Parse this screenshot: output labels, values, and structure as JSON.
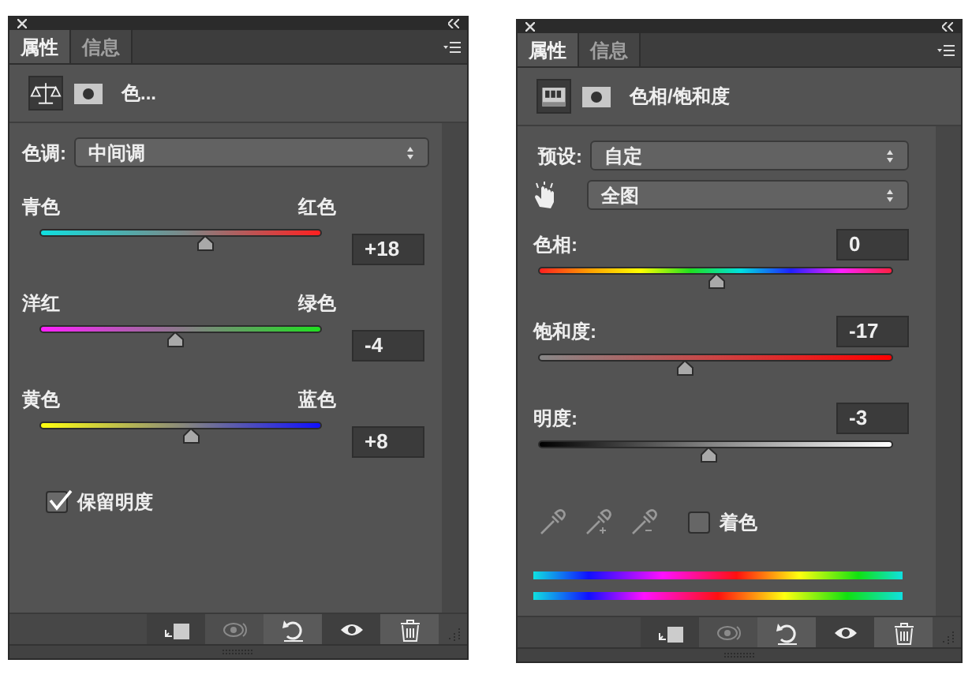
{
  "panels": [
    {
      "tabs": [
        {
          "label": "属性",
          "selected": true
        },
        {
          "label": "信息",
          "selected": false
        }
      ],
      "header": {
        "kind": "color_balance",
        "title": "色..."
      },
      "controls": [
        {
          "kind": "select",
          "label": "色调:",
          "value": "中间调"
        },
        {
          "kind": "pair_slider",
          "left_label": "青色",
          "right_label": "红色",
          "value": "+18",
          "slider": {
            "kind": "cyan_red",
            "level": 0.59
          }
        },
        {
          "kind": "pair_slider",
          "left_label": "洋红",
          "right_label": "绿色",
          "value": "-4",
          "slider": {
            "kind": "magenta_green",
            "level": 0.48
          }
        },
        {
          "kind": "pair_slider",
          "left_label": "黄色",
          "right_label": "蓝色",
          "value": "+8",
          "slider": {
            "kind": "yellow_blue",
            "level": 0.54
          }
        },
        {
          "kind": "checkbox",
          "label": "保留明度",
          "checked": true
        }
      ],
      "footer": [
        {
          "kind": "clip",
          "disabled": false
        },
        {
          "kind": "view_previous",
          "disabled": true
        },
        {
          "kind": "reset",
          "disabled": false
        },
        {
          "kind": "visibility",
          "disabled": false
        },
        {
          "kind": "delete",
          "disabled": false
        }
      ]
    },
    {
      "tabs": [
        {
          "label": "属性",
          "selected": true
        },
        {
          "label": "信息",
          "selected": false
        }
      ],
      "header": {
        "kind": "hue_saturation",
        "title": "色相/饱和度"
      },
      "controls": [
        {
          "kind": "select",
          "label": "预设:",
          "value": "自定"
        },
        {
          "kind": "target_select",
          "value": "全图"
        },
        {
          "kind": "labeled_slider",
          "label": "色相:",
          "value": "0",
          "slider": {
            "kind": "hue",
            "level": 0.5
          }
        },
        {
          "kind": "labeled_slider",
          "label": "饱和度:",
          "value": "-17",
          "slider": {
            "kind": "saturation",
            "level": 0.41
          }
        },
        {
          "kind": "labeled_slider",
          "label": "明度:",
          "value": "-3",
          "slider": {
            "kind": "lightness",
            "level": 0.48
          }
        },
        {
          "kind": "tools",
          "label": "着色",
          "checked": false
        },
        {
          "kind": "spectrum"
        }
      ],
      "footer": [
        {
          "kind": "clip",
          "disabled": false
        },
        {
          "kind": "view_previous",
          "disabled": true
        },
        {
          "kind": "reset",
          "disabled": false
        },
        {
          "kind": "visibility",
          "disabled": false
        },
        {
          "kind": "delete",
          "disabled": false
        }
      ]
    }
  ]
}
